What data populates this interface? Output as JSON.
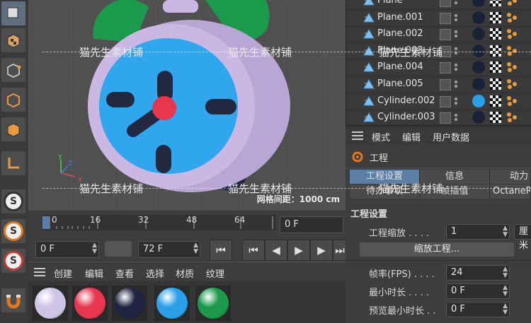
{
  "objects": [
    {
      "name": "Plane",
      "sphere_color": "#1a2238"
    },
    {
      "name": "Plane.001",
      "sphere_color": "#1a2238"
    },
    {
      "name": "Plane.002",
      "sphere_color": "#1a2238"
    },
    {
      "name": "Plane.003",
      "sphere_color": "#1a2238"
    },
    {
      "name": "Plane.004",
      "sphere_color": "#1a2238"
    },
    {
      "name": "Plane.005",
      "sphere_color": "#1a2238"
    },
    {
      "name": "Cylinder.002",
      "sphere_color": "#2aa0e8"
    },
    {
      "name": "Cylinder.003",
      "sphere_color": "#1a2238"
    }
  ],
  "viewport": {
    "grid_label": "网格间距：1000 cm",
    "axis_y": "Y",
    "axis_x": "X",
    "axis_z": "Z"
  },
  "timeline": {
    "ticks": [
      "0",
      "16",
      "32",
      "48",
      "64"
    ],
    "current_frame": "0 F"
  },
  "transport": {
    "start_frame": "0 F",
    "end_frame": "72 F"
  },
  "material_menu": [
    "创建",
    "编辑",
    "查看",
    "选择",
    "材质",
    "纹理"
  ],
  "materials": [
    "#cfc3e6",
    "#e8364f",
    "#1f2540",
    "#2aa0e8",
    "#1a9a4a"
  ],
  "attr_menu": [
    "模式",
    "编辑",
    "用户数据"
  ],
  "attr_title": "工程",
  "tabs_row1": [
    "工程设置",
    "信息",
    "动力学"
  ],
  "tabs_row2": [
    "待办事项",
    "帧插值",
    "OctaneRender"
  ],
  "section_title": "工程设置",
  "fields": {
    "scale_label": "工程缩放",
    "scale_value": "1",
    "scale_unit": "厘米",
    "scale_button": "缩放工程...",
    "fps_label": "帧率(FPS)",
    "fps_value": "24",
    "min_time_label": "最小时长",
    "min_time_value": "0 F",
    "preview_min_label": "预览最小时长",
    "preview_min_value": "0 F"
  },
  "watermark": "猫先生素材铺",
  "colors": {
    "accent": "#5a7fa8",
    "clock_face": "#2fa6ee",
    "clock_body": "#cbb8e2",
    "bell": "#1a9a4a",
    "center": "#e8364f"
  }
}
